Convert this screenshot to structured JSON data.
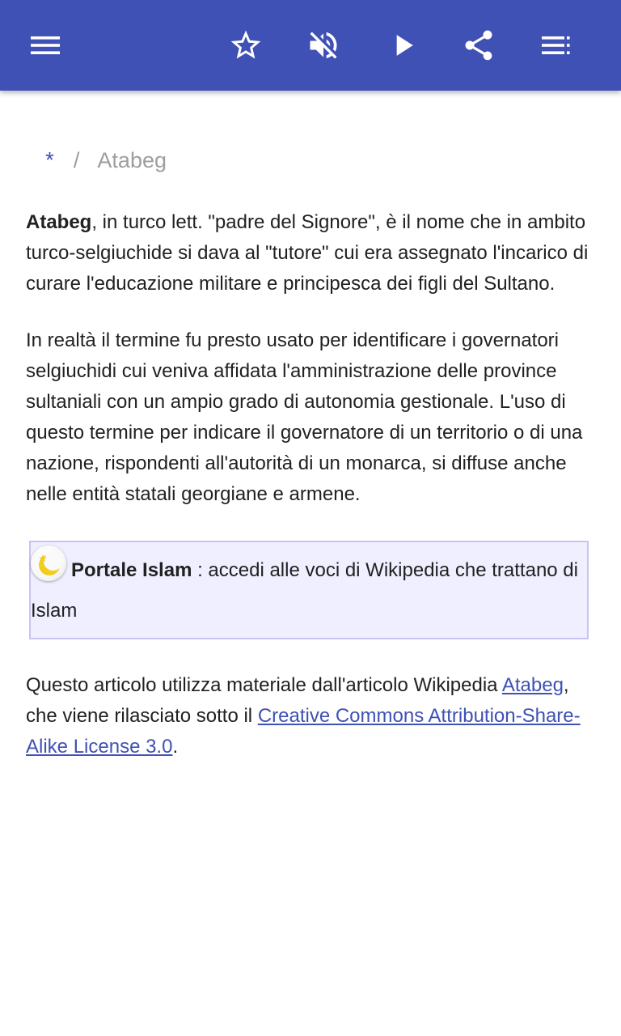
{
  "toolbar": {
    "menu_icon": "hamburger-menu-icon",
    "star_icon": "star-outline-icon",
    "mute_icon": "volume-off-icon",
    "play_icon": "play-icon",
    "share_icon": "share-icon",
    "list_icon": "playlist-icon",
    "background_color": "#3f51b5"
  },
  "breadcrumb": {
    "home": "*",
    "separator": "/",
    "current": "Atabeg"
  },
  "article": {
    "p1_bold": "Atabeg",
    "p1_rest": ", in turco lett. \"padre del Signore\", è il nome che in ambito turco-selgiuchide si dava al \"tutore\" cui era assegnato l'incarico di curare l'educazione militare e principesca dei figli del Sultano.",
    "p2": "In realtà il termine fu presto usato per identificare i governatori selgiuchidi cui veniva affidata l'amministrazione delle province sultaniali con un ampio grado di autonomia gestionale. L'uso di questo termine per indicare il governatore di un territorio o di una nazione, rispondenti all'autorità di un monarca, si diffuse anche nelle entità statali georgiane e armene.",
    "portal_icon": "crescent-star-icon",
    "portal_name": "Portale Islam",
    "portal_text": " : accedi alle voci di Wikipedia che trattano di Islam"
  },
  "attribution": {
    "prefix": "Questo articolo utilizza materiale dall'articolo Wikipedia ",
    "article_link": "Atabeg",
    "middle": ", che viene rilasciato sotto il ",
    "license_link": "Creative Commons Attribution-Share-Alike License 3.0",
    "suffix": "."
  },
  "colors": {
    "accent": "#3f51b5",
    "portal_bg": "#efefff",
    "portal_border": "#c5c5f5"
  }
}
